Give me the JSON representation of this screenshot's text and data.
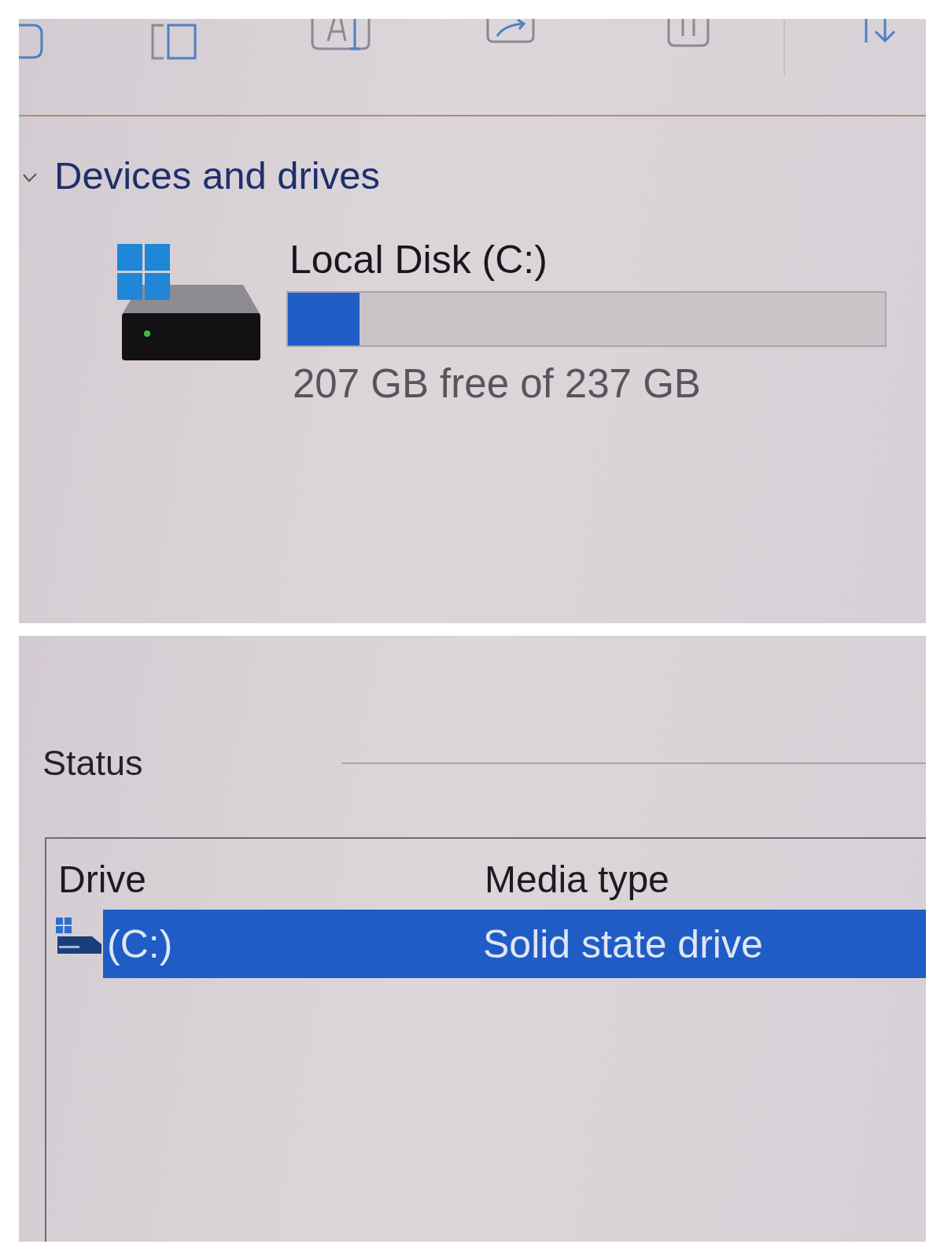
{
  "devices_and_drives": {
    "title": "Devices and drives",
    "expanded": true,
    "drives": [
      {
        "name": "Local Disk (C:)",
        "level": 0.12,
        "space": "207 GB free of 237 GB"
      }
    ]
  },
  "status": {
    "title": "Status",
    "columns": [
      "Drive",
      "Media type"
    ],
    "rows": [
      {
        "drive": "(C:)",
        "media_type": "Solid state drive",
        "selected": true
      }
    ]
  }
}
